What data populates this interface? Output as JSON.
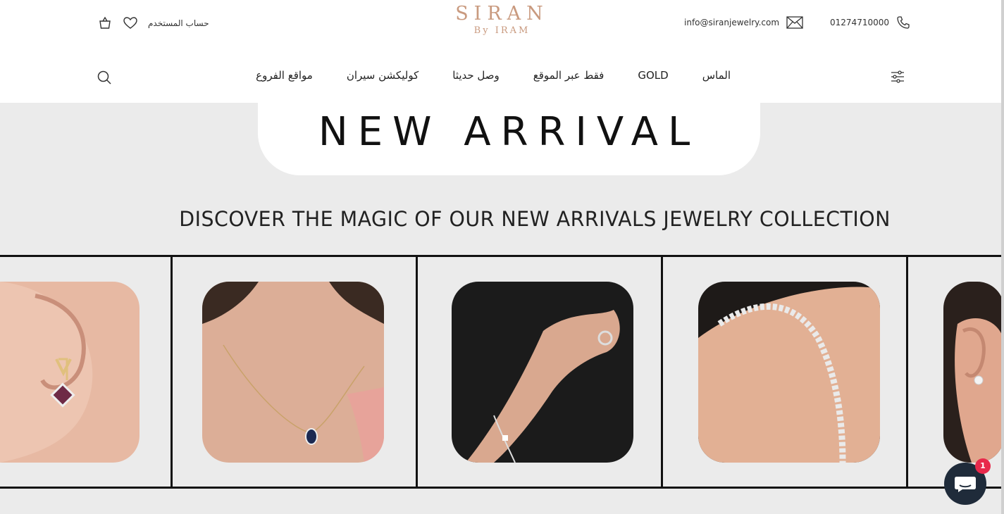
{
  "header": {
    "phone": "01274710000",
    "email": "info@siranjewelry.com",
    "account_label": "حساب المستخدم",
    "logo_main": "SIRAN",
    "logo_sub": "By IRAM"
  },
  "nav": {
    "items": [
      {
        "label": "الماس"
      },
      {
        "label": "GOLD"
      },
      {
        "label": "فقط عبر الموقع"
      },
      {
        "label": "وصل حديثا"
      },
      {
        "label": "كوليكشن سيران"
      },
      {
        "label": "مواقع الفروع"
      }
    ]
  },
  "banner": {
    "title": "NEW ARRIVAL"
  },
  "tagline": "DISCOVER THE MAGIC OF OUR NEW ARRIVALS JEWELRY COLLECTION",
  "products": [
    {
      "image": "earring-amethyst-photo"
    },
    {
      "image": "necklace-sapphire-photo"
    },
    {
      "image": "ring-bracelet-photo"
    },
    {
      "image": "tennis-bracelet-photo"
    },
    {
      "image": "stud-earring-photo"
    }
  ],
  "chat": {
    "badge_count": "1"
  },
  "colors": {
    "brand": "#c99a7f",
    "background": "#ebebeb",
    "chat": "#1f2b3a",
    "badge": "#e8294b"
  }
}
